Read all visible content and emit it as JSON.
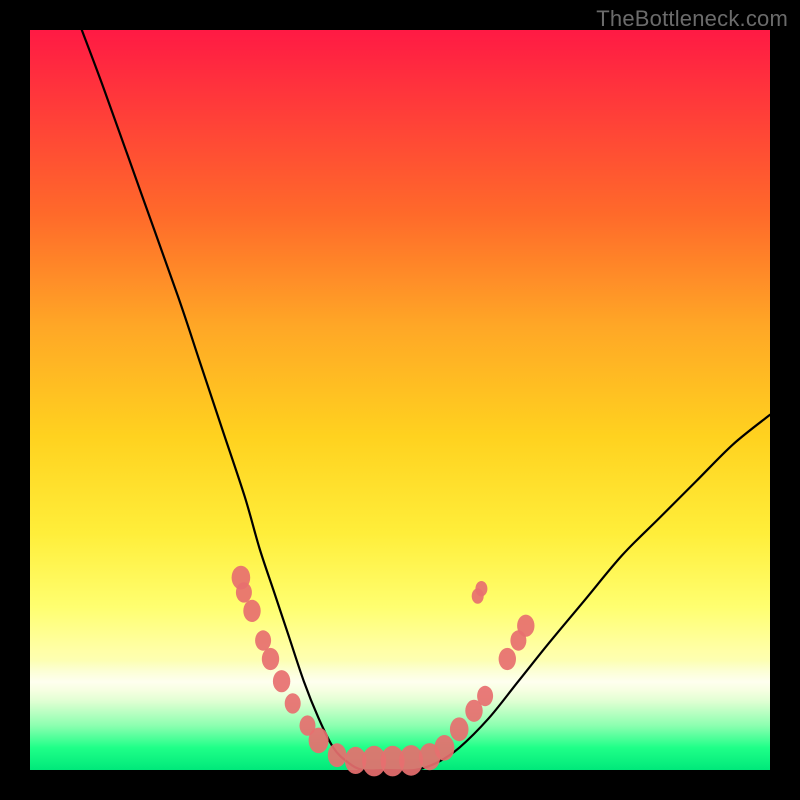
{
  "watermark": "TheBottleneck.com",
  "colors": {
    "frame": "#000000",
    "curve": "#000000",
    "marker_fill": "#e76f6f",
    "marker_stroke": "#d45a5a"
  },
  "chart_data": {
    "type": "line",
    "title": "",
    "xlabel": "",
    "ylabel": "",
    "xlim": [
      0,
      100
    ],
    "ylim": [
      0,
      100
    ],
    "grid": false,
    "legend": false,
    "series": [
      {
        "name": "bottleneck-curve",
        "x": [
          7,
          10,
          15,
          20,
          23,
          26,
          29,
          31,
          33,
          35,
          37,
          39,
          41,
          43,
          45,
          48,
          52,
          55,
          58,
          62,
          66,
          70,
          75,
          80,
          85,
          90,
          95,
          100
        ],
        "values": [
          100,
          92,
          78,
          64,
          55,
          46,
          37,
          30,
          24,
          18,
          12,
          7,
          3,
          1,
          0,
          0,
          0,
          1,
          3,
          7,
          12,
          17,
          23,
          29,
          34,
          39,
          44,
          48
        ]
      }
    ],
    "markers": [
      {
        "x": 28.5,
        "y": 26.0,
        "r": 1.4
      },
      {
        "x": 28.9,
        "y": 24.0,
        "r": 1.2
      },
      {
        "x": 30.0,
        "y": 21.5,
        "r": 1.3
      },
      {
        "x": 31.5,
        "y": 17.5,
        "r": 1.2
      },
      {
        "x": 32.5,
        "y": 15.0,
        "r": 1.3
      },
      {
        "x": 34.0,
        "y": 12.0,
        "r": 1.3
      },
      {
        "x": 35.5,
        "y": 9.0,
        "r": 1.2
      },
      {
        "x": 37.5,
        "y": 6.0,
        "r": 1.2
      },
      {
        "x": 39.0,
        "y": 4.0,
        "r": 1.5
      },
      {
        "x": 41.5,
        "y": 2.0,
        "r": 1.4
      },
      {
        "x": 44.0,
        "y": 1.3,
        "r": 1.6
      },
      {
        "x": 46.5,
        "y": 1.2,
        "r": 1.8
      },
      {
        "x": 49.0,
        "y": 1.2,
        "r": 1.8
      },
      {
        "x": 51.5,
        "y": 1.3,
        "r": 1.8
      },
      {
        "x": 54.0,
        "y": 1.8,
        "r": 1.6
      },
      {
        "x": 56.0,
        "y": 3.0,
        "r": 1.5
      },
      {
        "x": 58.0,
        "y": 5.5,
        "r": 1.4
      },
      {
        "x": 60.0,
        "y": 8.0,
        "r": 1.3
      },
      {
        "x": 61.5,
        "y": 10.0,
        "r": 1.2
      },
      {
        "x": 64.5,
        "y": 15.0,
        "r": 1.3
      },
      {
        "x": 66.0,
        "y": 17.5,
        "r": 1.2
      },
      {
        "x": 67.0,
        "y": 19.5,
        "r": 1.3
      },
      {
        "x": 60.5,
        "y": 23.5,
        "r": 0.9
      },
      {
        "x": 61.0,
        "y": 24.5,
        "r": 0.9
      }
    ]
  }
}
